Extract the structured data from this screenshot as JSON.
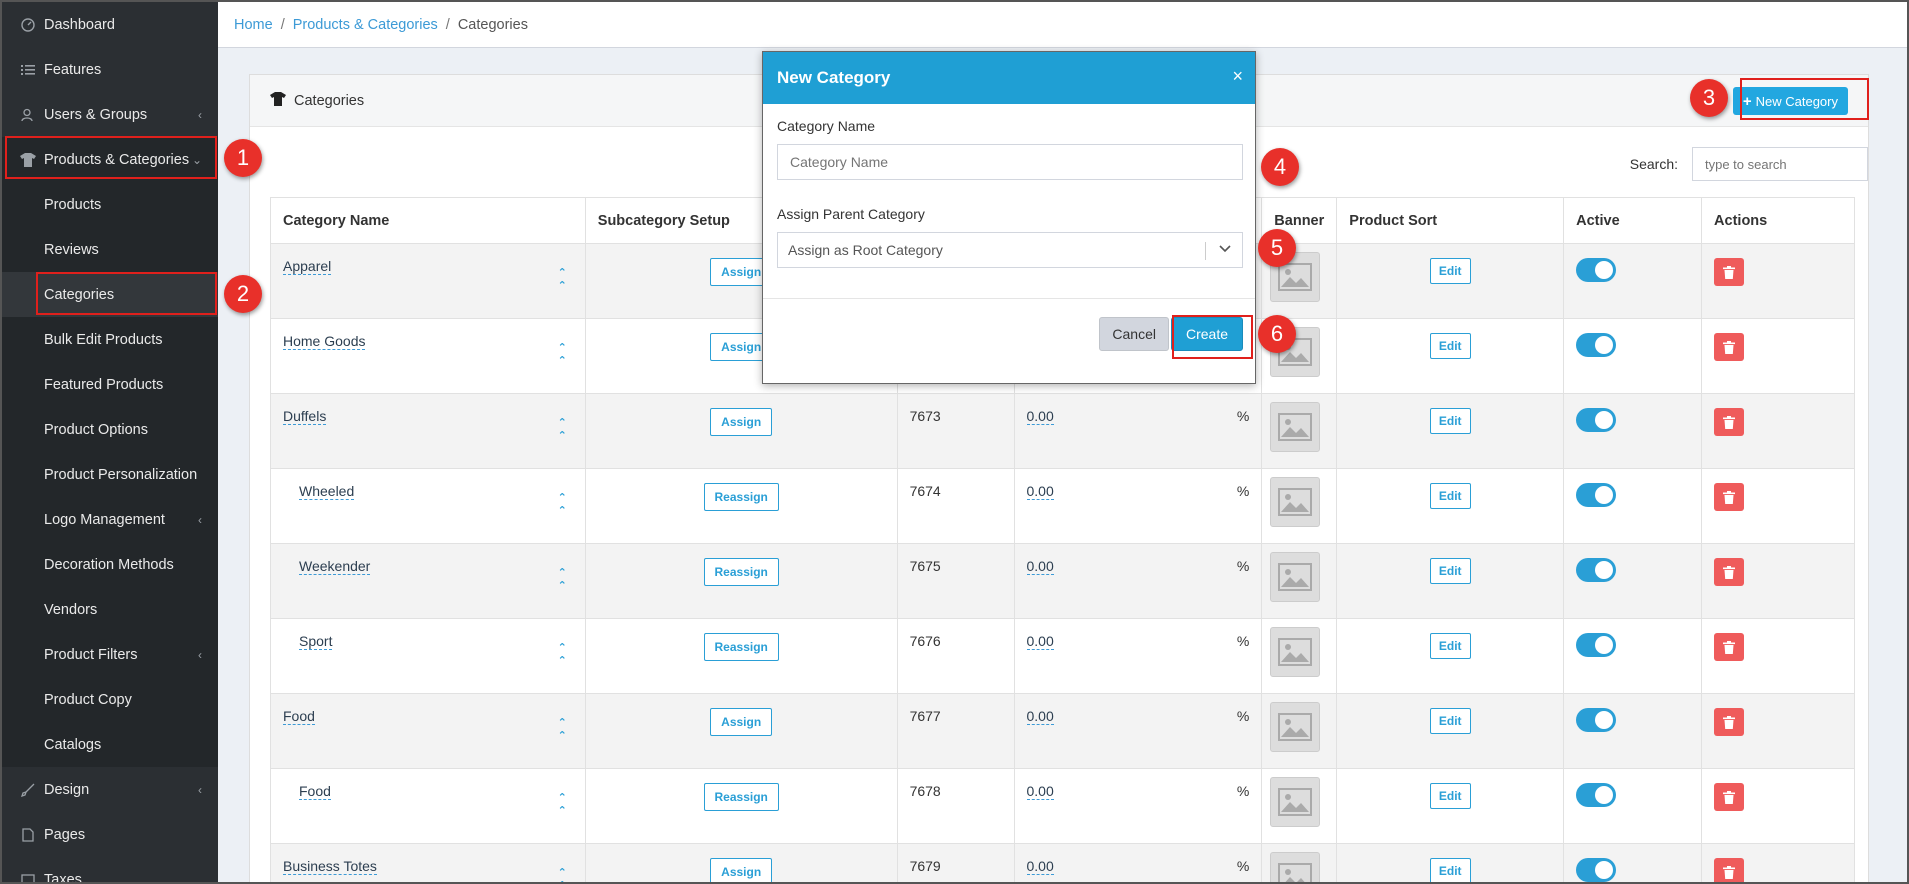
{
  "sidebar": {
    "items": [
      {
        "label": "Dashboard",
        "icon": "dashboard-icon"
      },
      {
        "label": "Features",
        "icon": "list-icon"
      },
      {
        "label": "Users & Groups",
        "icon": "users-icon"
      },
      {
        "label": "Products & Categories",
        "icon": "shirt-icon"
      },
      {
        "label": "Products"
      },
      {
        "label": "Reviews"
      },
      {
        "label": "Categories"
      },
      {
        "label": "Bulk Edit Products"
      },
      {
        "label": "Featured Products"
      },
      {
        "label": "Product Options"
      },
      {
        "label": "Product Personalization"
      },
      {
        "label": "Logo Management"
      },
      {
        "label": "Decoration Methods"
      },
      {
        "label": "Vendors"
      },
      {
        "label": "Product Filters"
      },
      {
        "label": "Product Copy"
      },
      {
        "label": "Catalogs"
      },
      {
        "label": "Design",
        "icon": "brush-icon"
      },
      {
        "label": "Pages",
        "icon": "file-icon"
      },
      {
        "label": "Taxes"
      }
    ]
  },
  "breadcrumb": {
    "home": "Home",
    "section": "Products & Categories",
    "current": "Categories",
    "sep": "/"
  },
  "card": {
    "title": "Categories",
    "new_button": "New Category"
  },
  "search": {
    "label": "Search:",
    "placeholder": "type to search"
  },
  "table": {
    "headers": {
      "name": "Category Name",
      "subcat": "Subcategory Setup",
      "banner": "Banner",
      "sort": "Product Sort",
      "active": "Active",
      "actions": "Actions"
    },
    "edit_label": "Edit",
    "rows": [
      {
        "name": "Apparel",
        "setup": "Assign",
        "id": "",
        "value": "",
        "pct": ""
      },
      {
        "name": "Home Goods",
        "setup": "Assign",
        "id": "",
        "value": "",
        "pct": ""
      },
      {
        "name": "Duffels",
        "setup": "Assign",
        "id": "7673",
        "value": "0.00",
        "pct": "%"
      },
      {
        "name": "Wheeled",
        "setup": "Reassign",
        "id": "7674",
        "value": "0.00",
        "pct": "%"
      },
      {
        "name": "Weekender",
        "setup": "Reassign",
        "id": "7675",
        "value": "0.00",
        "pct": "%"
      },
      {
        "name": "Sport",
        "setup": "Reassign",
        "id": "7676",
        "value": "0.00",
        "pct": "%"
      },
      {
        "name": "Food",
        "setup": "Assign",
        "id": "7677",
        "value": "0.00",
        "pct": "%"
      },
      {
        "name": "Food",
        "setup": "Reassign",
        "id": "7678",
        "value": "0.00",
        "pct": "%"
      },
      {
        "name": "Business Totes",
        "setup": "Assign",
        "id": "7679",
        "value": "0.00",
        "pct": "%"
      }
    ]
  },
  "modal": {
    "title": "New Category",
    "close": "×",
    "name_label": "Category Name",
    "name_placeholder": "Category Name",
    "parent_label": "Assign Parent Category",
    "parent_value": "Assign as Root Category",
    "cancel": "Cancel",
    "create": "Create"
  },
  "callouts": [
    "1",
    "2",
    "3",
    "4",
    "5",
    "6"
  ],
  "colors": {
    "accent": "#1f9fd4",
    "highlight": "#e0201c",
    "callout": "#e8302a",
    "danger": "#ef5b5b"
  }
}
